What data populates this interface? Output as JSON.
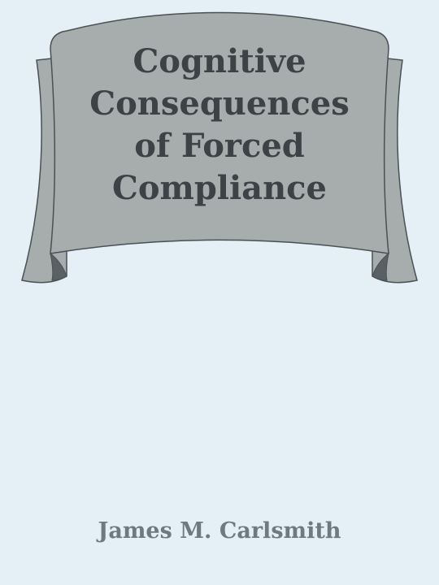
{
  "cover": {
    "title_lines": [
      "Cognitive",
      "Consequences",
      "of Forced",
      "Compliance"
    ],
    "author": "James M. Carlsmith"
  },
  "colors": {
    "background": "#e4f0f5",
    "banner_fill": "#a7acac",
    "banner_shadow": "#5a6063",
    "banner_outline": "#4a5054",
    "title_text": "#3c4246",
    "author_text": "#6f7a80"
  },
  "icons": {
    "banner": "ribbon-banner-icon"
  }
}
